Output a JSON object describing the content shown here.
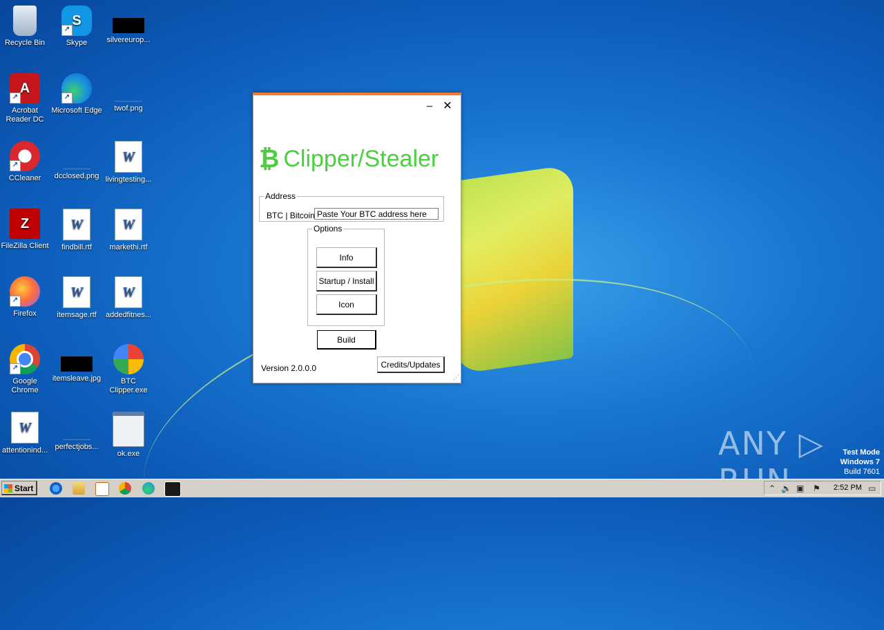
{
  "desktop": {
    "icons": [
      {
        "label": "Recycle Bin"
      },
      {
        "label": "Skype"
      },
      {
        "label": "silvereurop..."
      },
      {
        "label": "Acrobat Reader DC"
      },
      {
        "label": "Microsoft Edge"
      },
      {
        "label": "twof.png"
      },
      {
        "label": "CCleaner"
      },
      {
        "label": "dcclosed.png"
      },
      {
        "label": "livingtesting..."
      },
      {
        "label": "FileZilla Client"
      },
      {
        "label": "findbill.rtf"
      },
      {
        "label": "markethi.rtf"
      },
      {
        "label": "Firefox"
      },
      {
        "label": "itemsage.rtf"
      },
      {
        "label": "addedfitnes..."
      },
      {
        "label": "Google Chrome"
      },
      {
        "label": "itemsleave.jpg"
      },
      {
        "label": "BTC Clipper.exe"
      },
      {
        "label": "attentionind..."
      },
      {
        "label": "perfectjobs..."
      },
      {
        "label": "ok.exe"
      }
    ]
  },
  "app": {
    "minimize": "–",
    "close": "✕",
    "logo_symbol": "₿",
    "logo_text": "Clipper/Stealer",
    "address_legend": "Address",
    "address_label": "BTC | Bitcoin",
    "address_value": "Paste Your BTC address here",
    "options_legend": "Options",
    "info_label": "Info",
    "startup_label": "Startup / Install",
    "icon_label": "Icon",
    "build_label": "Build",
    "version": "Version 2.0.0.0",
    "credits_label": "Credits/Updates"
  },
  "watermark": "ANY ▷ RUN",
  "system": {
    "test_mode": "Test Mode",
    "os": "Windows 7",
    "build": "Build 7601"
  },
  "taskbar": {
    "start_label": "Start",
    "clock": "2:52 PM"
  }
}
